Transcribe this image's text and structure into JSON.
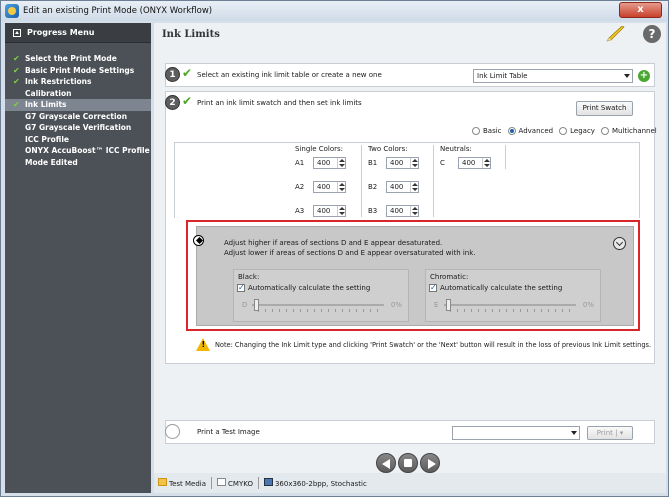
{
  "window": {
    "title": "Edit an existing Print Mode (ONYX Workflow)",
    "close": "x"
  },
  "sidebar": {
    "header": "Progress Menu",
    "items": [
      {
        "label": "Select the Print Mode",
        "checked": true
      },
      {
        "label": "Basic Print Mode Settings",
        "checked": true
      },
      {
        "label": "Ink Restrictions",
        "checked": true
      },
      {
        "label": "Calibration",
        "checked": false
      },
      {
        "label": "Ink Limits",
        "checked": true,
        "active": true
      },
      {
        "label": "G7 Grayscale Correction",
        "checked": false
      },
      {
        "label": "G7 Grayscale Verification",
        "checked": false
      },
      {
        "label": "ICC Profile",
        "checked": false
      },
      {
        "label": "ONYX AccuBoost™ ICC Profile",
        "checked": false
      },
      {
        "label": "Mode Edited",
        "checked": false
      }
    ]
  },
  "main": {
    "title": "Ink Limits",
    "help": "?"
  },
  "step1": {
    "number": "1",
    "text": "Select an existing ink limit table or create a new one",
    "dropdown_value": "Ink Limit Table"
  },
  "step2": {
    "number": "2",
    "text": "Print an ink limit swatch and then set ink limits",
    "print_swatch": "Print Swatch",
    "modes": [
      "Basic",
      "Advanced",
      "Legacy",
      "Multichannel"
    ],
    "selected_mode": "Advanced",
    "single_colors": {
      "label": "Single Colors:",
      "rows": [
        {
          "name": "A1",
          "value": "400"
        },
        {
          "name": "A2",
          "value": "400"
        },
        {
          "name": "A3",
          "value": "400"
        }
      ]
    },
    "two_colors": {
      "label": "Two Colors:",
      "rows": [
        {
          "name": "B1",
          "value": "400"
        },
        {
          "name": "B2",
          "value": "400"
        },
        {
          "name": "B3",
          "value": "400"
        }
      ]
    },
    "neutrals": {
      "label": "Neutrals:",
      "rows": [
        {
          "name": "C",
          "value": "400"
        }
      ]
    },
    "advanced": {
      "line1": "Adjust higher if areas of sections D and E appear desaturated.",
      "line2": "Adjust lower if areas of sections D and E appear oversaturated with ink.",
      "black": {
        "label": "Black:",
        "auto": "Automatically calculate the setting",
        "slider_label": "D",
        "value": "0%",
        "level": 0
      },
      "chromatic": {
        "label": "Chromatic:",
        "auto": "Automatically calculate the setting",
        "slider_label": "E",
        "value": "0%",
        "level": 0
      }
    },
    "note": "Note: Changing the Ink Limit type and clicking 'Print Swatch' or the 'Next' button will result in the loss of previous Ink Limit settings."
  },
  "step3": {
    "text": "Print a Test Image",
    "dropdown_value": "",
    "print_button": "Print"
  },
  "statusbar": {
    "media": "Test Media",
    "colorspace": "CMYKO",
    "resolution": "360x360-2bpp, Stochastic"
  }
}
